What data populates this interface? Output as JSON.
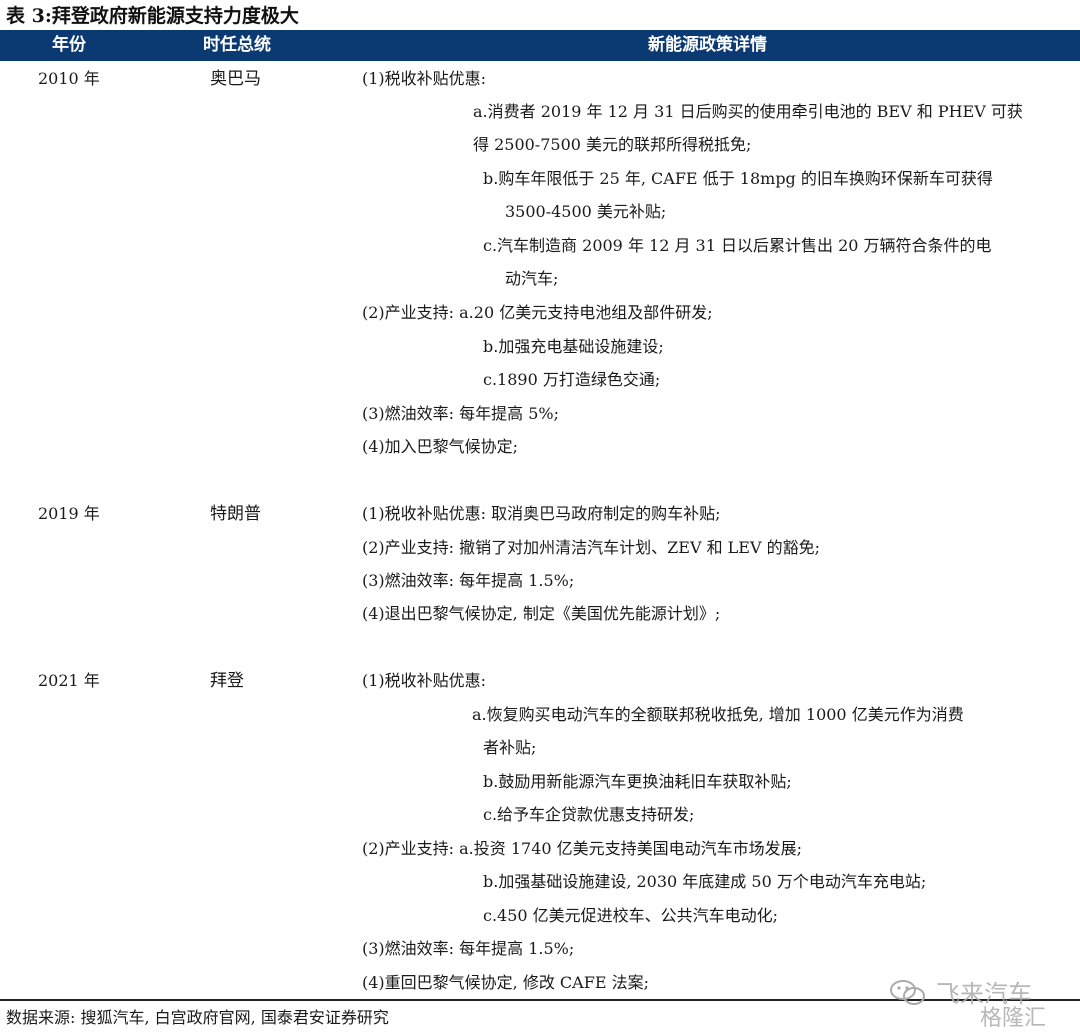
{
  "title": "表 3:拜登政府新能源支持力度极大",
  "header": {
    "year": "年份",
    "president": "时任总统",
    "detail": "新能源政策详情"
  },
  "rows": [
    {
      "year": "2010 年",
      "president": "奥巴马",
      "lines": [
        "(1)税收补贴优惠:",
        "a.消费者 2019 年 12 月 31 日后购买的使用牵引电池的 BEV 和 PHEV 可获",
        "得 2500-7500 美元的联邦所得税抵免;",
        "b.购车年限低于 25 年, CAFE 低于 18mpg 的旧车换购环保新车可获得",
        "3500-4500 美元补贴;",
        "c.汽车制造商 2009 年 12 月 31 日以后累计售出 20 万辆符合条件的电",
        "动汽车;",
        "(2)产业支持: a.20 亿美元支持电池组及部件研发;",
        "b.加强充电基础设施建设;",
        "c.1890 万打造绿色交通;",
        "(3)燃油效率: 每年提高 5%;",
        "(4)加入巴黎气候协定;"
      ]
    },
    {
      "year": "2019 年",
      "president": "特朗普",
      "lines": [
        "(1)税收补贴优惠: 取消奥巴马政府制定的购车补贴;",
        "(2)产业支持: 撤销了对加州清洁汽车计划、ZEV 和 LEV 的豁免;",
        "(3)燃油效率: 每年提高 1.5%;",
        "(4)退出巴黎气候协定, 制定《美国优先能源计划》;"
      ]
    },
    {
      "year": "2021 年",
      "president": "拜登",
      "lines": [
        "(1)税收补贴优惠:",
        "a.恢复购买电动汽车的全额联邦税收抵免, 增加 1000 亿美元作为消费",
        "者补贴;",
        "b.鼓励用新能源汽车更换油耗旧车获取补贴;",
        "c.给予车企贷款优惠支持研发;",
        "(2)产业支持: a.投资 1740 亿美元支持美国电动汽车市场发展;",
        "b.加强基础设施建设, 2030 年底建成 50 万个电动汽车充电站;",
        "c.450 亿美元促进校车、公共汽车电动化;",
        "(3)燃油效率: 每年提高 1.5%;",
        "(4)重回巴黎气候协定, 修改 CAFE 法案;"
      ]
    }
  ],
  "source": "数据来源: 搜狐汽车, 白宫政府官网, 国泰君安证券研究",
  "watermark": {
    "text1": "飞来汽车",
    "text2": "格隆汇",
    "icon": "wechat-icon"
  },
  "colors": {
    "header_bg": "#0b3a73",
    "header_text": "#ffffff"
  }
}
